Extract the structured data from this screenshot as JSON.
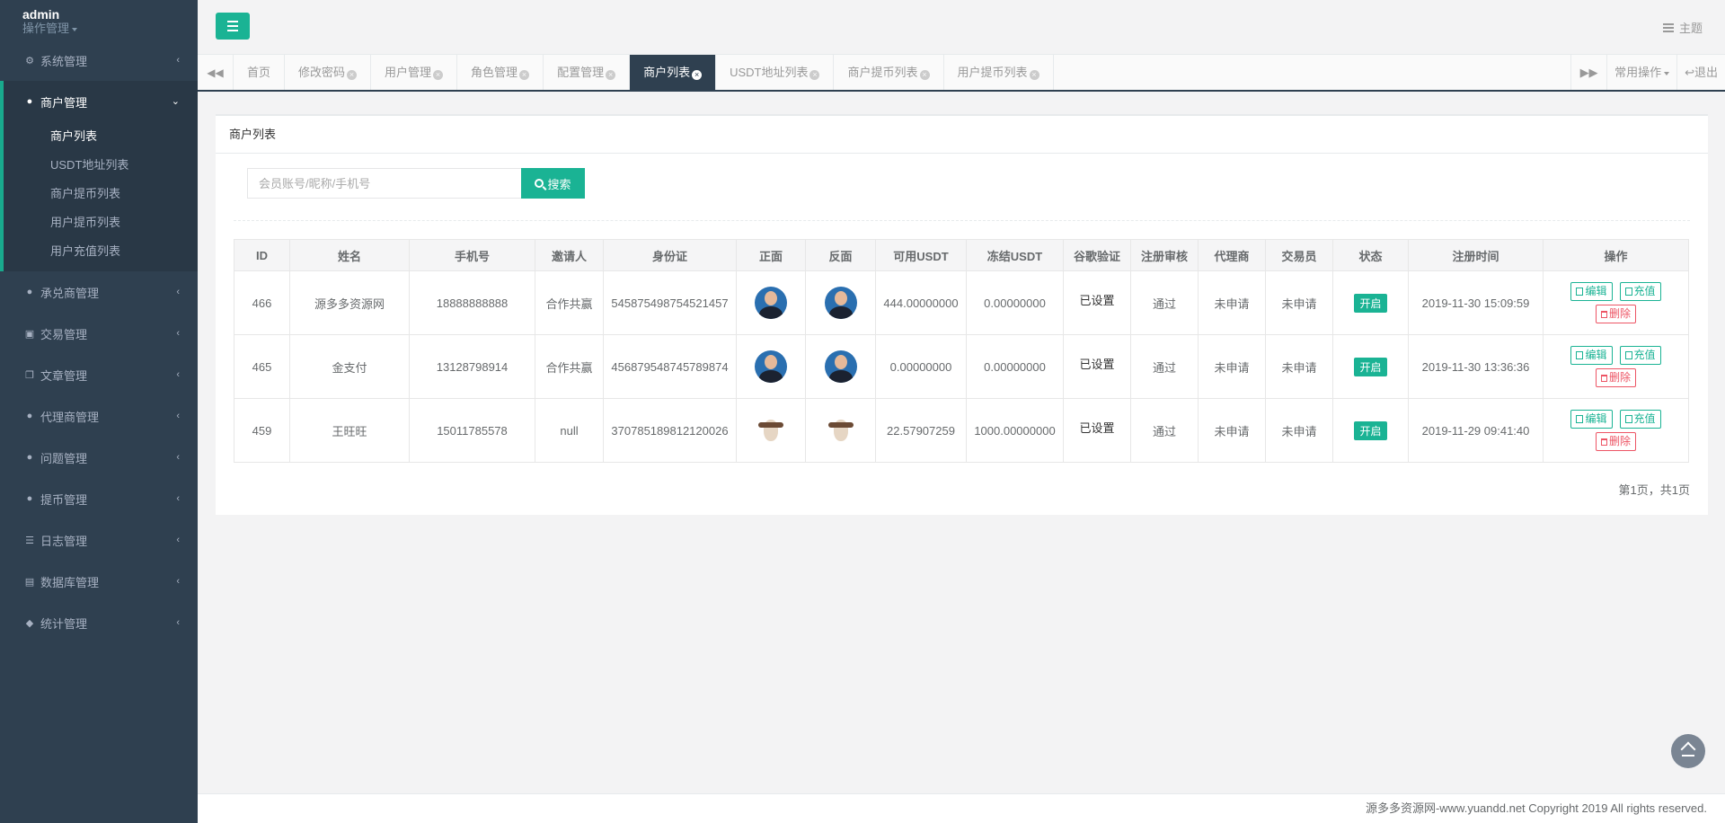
{
  "user": {
    "name": "admin",
    "role": "操作管理"
  },
  "sidebar": {
    "items_before": [
      {
        "label": "系统管理",
        "icon": "gear-icon"
      }
    ],
    "active": {
      "label": "商户管理",
      "icon": "user-icon",
      "children": [
        {
          "label": "商户列表"
        },
        {
          "label": "USDT地址列表"
        },
        {
          "label": "商户提币列表"
        },
        {
          "label": "用户提币列表"
        },
        {
          "label": "用户充值列表"
        }
      ]
    },
    "items_after": [
      {
        "label": "承兑商管理",
        "icon": "user-icon"
      },
      {
        "label": "交易管理",
        "icon": "image-icon"
      },
      {
        "label": "文章管理",
        "icon": "copy-icon"
      },
      {
        "label": "代理商管理",
        "icon": "user-icon"
      },
      {
        "label": "问题管理",
        "icon": "comment-icon"
      },
      {
        "label": "提币管理",
        "icon": "user-icon"
      },
      {
        "label": "日志管理",
        "icon": "list-icon"
      },
      {
        "label": "数据库管理",
        "icon": "database-icon"
      },
      {
        "label": "统计管理",
        "icon": "cube-icon"
      }
    ]
  },
  "topbar": {
    "theme_label": "主题"
  },
  "tabs": [
    {
      "label": "首页",
      "closable": false,
      "active": false
    },
    {
      "label": "修改密码",
      "closable": true,
      "active": false
    },
    {
      "label": "用户管理",
      "closable": true,
      "active": false
    },
    {
      "label": "角色管理",
      "closable": true,
      "active": false
    },
    {
      "label": "配置管理",
      "closable": true,
      "active": false
    },
    {
      "label": "商户列表",
      "closable": true,
      "active": true
    },
    {
      "label": "USDT地址列表",
      "closable": true,
      "active": false
    },
    {
      "label": "商户提币列表",
      "closable": true,
      "active": false
    },
    {
      "label": "用户提币列表",
      "closable": true,
      "active": false
    }
  ],
  "tab_actions": {
    "common_ops": "常用操作",
    "logout": "退出"
  },
  "panel": {
    "title": "商户列表",
    "search_placeholder": "会员账号/昵称/手机号",
    "search_button": "搜索"
  },
  "table": {
    "columns": [
      "ID",
      "姓名",
      "手机号",
      "邀请人",
      "身份证",
      "正面",
      "反面",
      "可用USDT",
      "冻结USDT",
      "谷歌验证",
      "注册审核",
      "代理商",
      "交易员",
      "状态",
      "注册时间",
      "操作"
    ],
    "rows": [
      {
        "id": "466",
        "name": "源多多资源网",
        "phone": "18888888888",
        "inviter": "合作共赢",
        "idcard": "545875498754521457",
        "front": "person",
        "back": "person",
        "usdt": "444.00000000",
        "frozen": "0.00000000",
        "google": "已设置",
        "review": "通过",
        "agent": "未申请",
        "trader": "未申请",
        "status": "开启",
        "time": "2019-11-30 15:09:59"
      },
      {
        "id": "465",
        "name": "金支付",
        "phone": "13128798914",
        "inviter": "合作共赢",
        "idcard": "456879548745789874",
        "front": "person",
        "back": "person",
        "usdt": "0.00000000",
        "frozen": "0.00000000",
        "google": "已设置",
        "review": "通过",
        "agent": "未申请",
        "trader": "未申请",
        "status": "开启",
        "time": "2019-11-30 13:36:36"
      },
      {
        "id": "459",
        "name": "王旺旺",
        "phone": "15011785578",
        "inviter": "null",
        "idcard": "370785189812120026",
        "front": "cow",
        "back": "cow",
        "usdt": "22.57907259",
        "frozen": "1000.00000000",
        "google": "已设置",
        "review": "通过",
        "agent": "未申请",
        "trader": "未申请",
        "status": "开启",
        "time": "2019-11-29 09:41:40"
      }
    ],
    "actions": {
      "edit": "编辑",
      "recharge": "充值",
      "delete": "删除"
    }
  },
  "pager": "第1页，共1页",
  "footer": "源多多资源网-www.yuandd.net Copyright 2019 All rights reserved.",
  "colors": {
    "sidebar": "#2f4050",
    "accent": "#1ab394",
    "danger": "#ed5565"
  }
}
